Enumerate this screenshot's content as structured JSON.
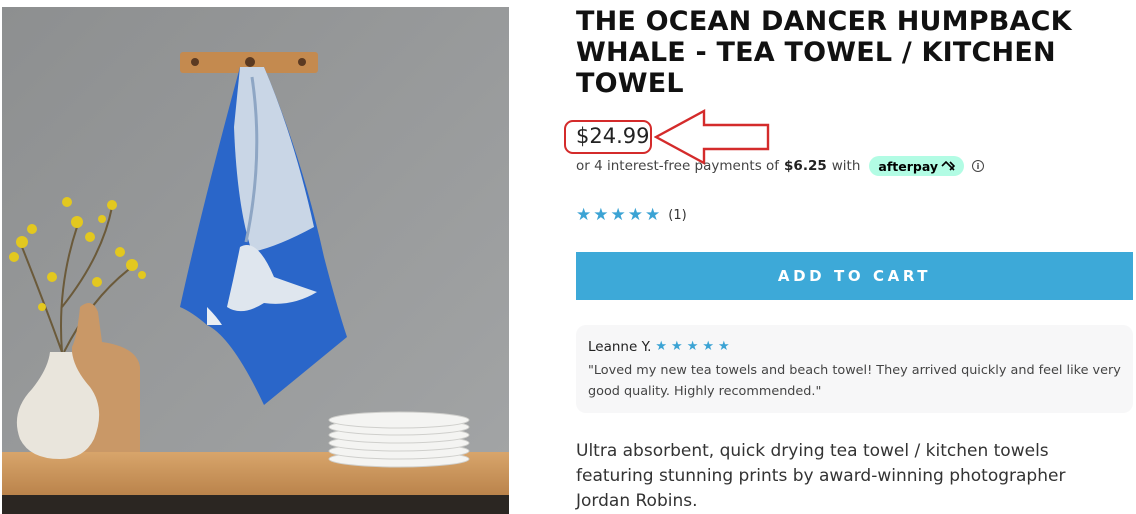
{
  "product": {
    "title": "THE OCEAN DANCER HUMPBACK WHALE - TEA TOWEL / KITCHEN TOWEL",
    "price": "$24.99",
    "installments": {
      "prefix": "or 4 interest-free payments of",
      "amount": "$6.25",
      "suffix": "with",
      "provider": "afterpay"
    },
    "rating": {
      "stars": 5,
      "count": "(1)"
    },
    "add_to_cart_label": "ADD TO CART",
    "description": "Ultra absorbent, quick drying tea towel / kitchen towels featuring stunning prints by award-winning photographer Jordan Robins."
  },
  "review": {
    "author": "Leanne Y.",
    "stars": 5,
    "text": "\"Loved my new tea towels and beach towel! They arrived quickly and feel like very good quality. Highly recommended.\""
  },
  "icons": {
    "star": "star-icon",
    "info": "info-icon",
    "afterpay": "afterpay-arrows-icon",
    "annotation_arrow": "red-arrow-annotation"
  },
  "colors": {
    "accent": "#3da9d8",
    "star": "#3ba3d4",
    "afterpay_badge": "#b2fce4",
    "annotation": "#d42b2b"
  }
}
